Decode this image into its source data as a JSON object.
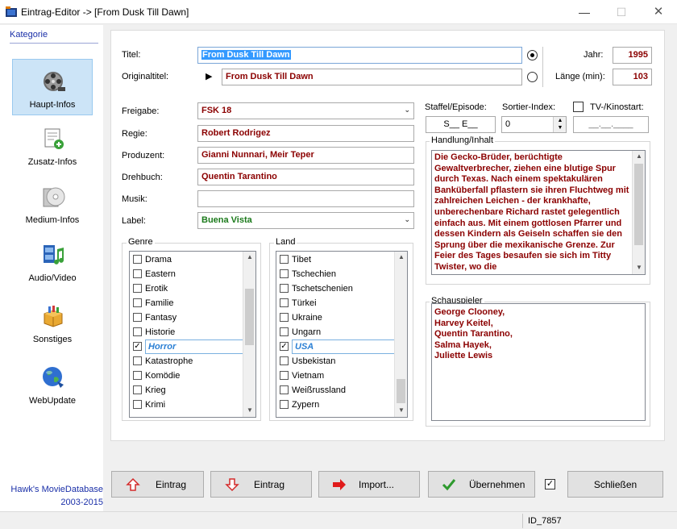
{
  "window": {
    "title": "Eintrag-Editor -> [From Dusk Till Dawn]",
    "minimize": "—",
    "maximize": "☐",
    "close": "✕"
  },
  "sidebar": {
    "header": "Kategorie",
    "items": [
      {
        "label": "Haupt-Infos",
        "icon": "film-reel-icon",
        "active": true
      },
      {
        "label": "Zusatz-Infos",
        "icon": "document-add-icon",
        "active": false
      },
      {
        "label": "Medium-Infos",
        "icon": "disc-icon",
        "active": false
      },
      {
        "label": "Audio/Video",
        "icon": "film-music-icon",
        "active": false
      },
      {
        "label": "Sonstiges",
        "icon": "box-icon",
        "active": false
      },
      {
        "label": "WebUpdate",
        "icon": "globe-icon",
        "active": false
      }
    ],
    "credit_line1": "Hawk's MovieDatabase",
    "credit_line2": "2003-2015"
  },
  "form": {
    "titel_label": "Titel:",
    "titel_value": "From Dusk Till Dawn",
    "originaltitel_label": "Originaltitel:",
    "originaltitel_value": "From Dusk Till Dawn",
    "jahr_label": "Jahr:",
    "jahr_value": "1995",
    "laenge_label": "Länge (min):",
    "laenge_value": "103",
    "freigabe_label": "Freigabe:",
    "freigabe_value": "FSK 18",
    "regie_label": "Regie:",
    "regie_value": "Robert Rodrigez",
    "produzent_label": "Produzent:",
    "produzent_value": "Gianni Nunnari, Meir Teper",
    "drehbuch_label": "Drehbuch:",
    "drehbuch_value": "Quentin Tarantino",
    "musik_label": "Musik:",
    "musik_value": "",
    "label_label": "Label:",
    "label_value": "Buena Vista",
    "staffel_label": "Staffel/Episode:",
    "staffel_value": "S__ E__",
    "sortier_label": "Sortier-Index:",
    "sortier_value": "0",
    "tv_label": "TV-/Kinostart:",
    "tv_value": "__.__.____",
    "handlung_label": "Handlung/Inhalt",
    "handlung_text": "Die Gecko-Brüder, berüchtigte Gewaltverbrecher, ziehen eine blutige Spur durch Texas. Nach einem spektakulären Banküberfall pflastern sie ihren Fluchtweg mit zahlreichen Leichen - der krankhafte, unberechenbare Richard rastet gelegentlich einfach aus. Mit einem gottlosen Pfarrer und dessen Kindern als Geiseln schaffen sie den Sprung über die mexikanische Grenze. Zur Feier des Tages besaufen sie sich im Titty Twister, wo die",
    "schauspieler_label": "Schauspieler",
    "schauspieler_lines": [
      "George Clooney,",
      "Harvey Keitel,",
      "Quentin Tarantino,",
      "Salma Hayek,",
      "Juliette Lewis"
    ],
    "genre_label": "Genre",
    "genre_items": [
      {
        "label": "Drama",
        "checked": false
      },
      {
        "label": "Eastern",
        "checked": false
      },
      {
        "label": "Erotik",
        "checked": false
      },
      {
        "label": "Familie",
        "checked": false
      },
      {
        "label": "Fantasy",
        "checked": false
      },
      {
        "label": "Historie",
        "checked": false
      },
      {
        "label": "Horror",
        "checked": true
      },
      {
        "label": "Katastrophe",
        "checked": false
      },
      {
        "label": "Komödie",
        "checked": false
      },
      {
        "label": "Krieg",
        "checked": false
      },
      {
        "label": "Krimi",
        "checked": false
      }
    ],
    "land_label": "Land",
    "land_items": [
      {
        "label": "Tibet",
        "checked": false
      },
      {
        "label": "Tschechien",
        "checked": false
      },
      {
        "label": "Tschetschenien",
        "checked": false
      },
      {
        "label": "Türkei",
        "checked": false
      },
      {
        "label": "Ukraine",
        "checked": false
      },
      {
        "label": "Ungarn",
        "checked": false
      },
      {
        "label": "USA",
        "checked": true
      },
      {
        "label": "Usbekistan",
        "checked": false
      },
      {
        "label": "Vietnam",
        "checked": false
      },
      {
        "label": "Weißrussland",
        "checked": false
      },
      {
        "label": "Zypern",
        "checked": false
      }
    ]
  },
  "buttons": {
    "eintrag_up": "Eintrag",
    "eintrag_down": "Eintrag",
    "import": "Import...",
    "uebernehmen": "Übernehmen",
    "schliessen": "Schließen"
  },
  "status": {
    "id": "ID_7857"
  },
  "colors": {
    "value_red": "#8b0000",
    "value_green": "#1b7a1b",
    "link_blue": "#1a2fa8",
    "selection_blue": "#2a7fd4",
    "nav_active_bg": "#cce4f7"
  }
}
